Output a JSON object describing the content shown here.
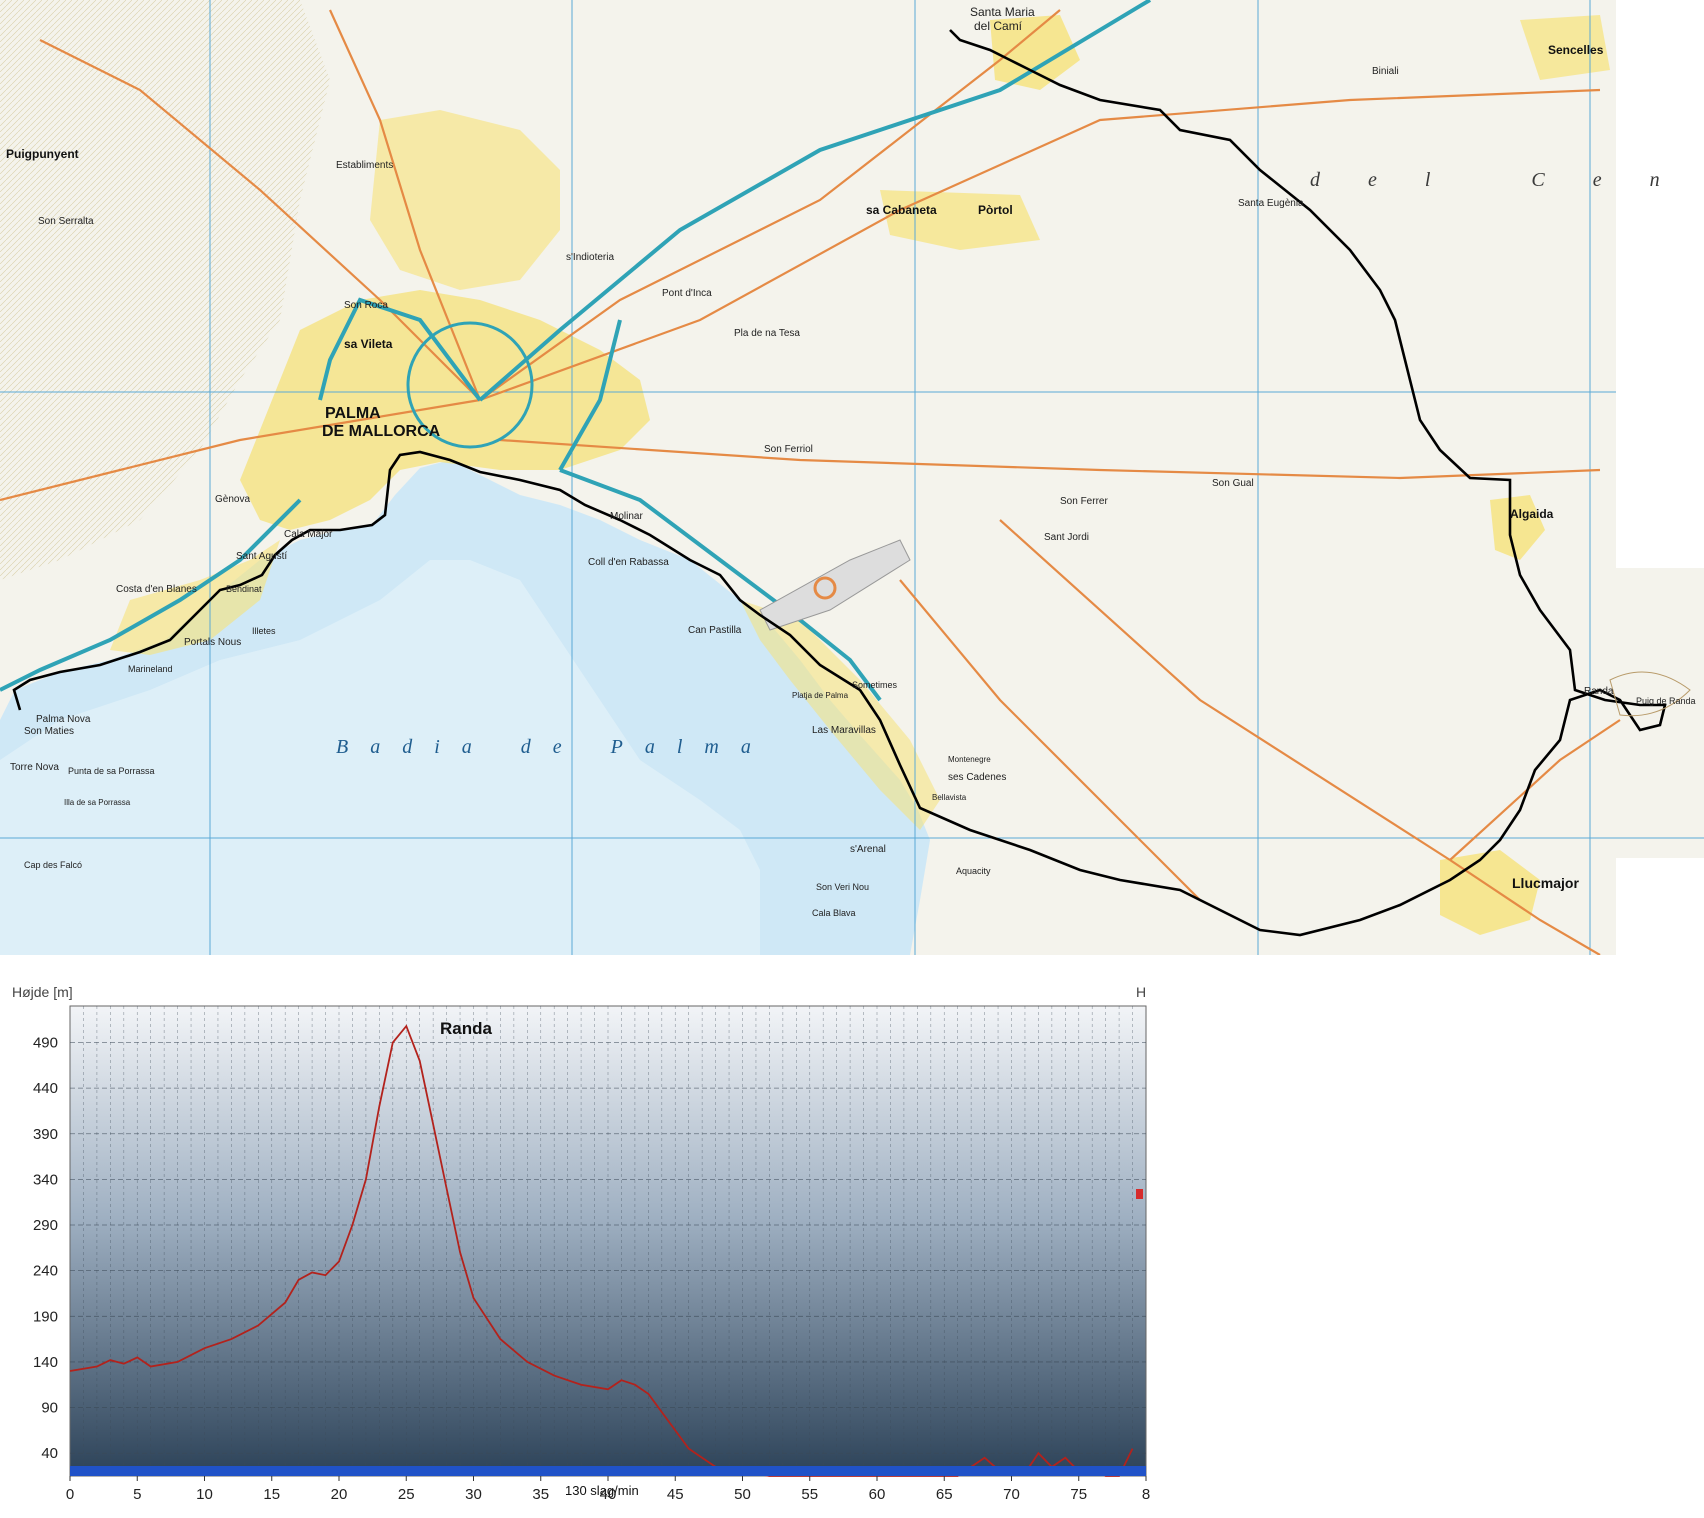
{
  "map": {
    "bay_name": "Badia de Palma",
    "region_name": "del Centro",
    "places": [
      {
        "name": "PALMA",
        "kind": "major"
      },
      {
        "name": "DE MALLORCA",
        "kind": "major"
      },
      {
        "name": "Santa Maria",
        "kind": "town"
      },
      {
        "name": "del Camí",
        "kind": "town"
      },
      {
        "name": "Sencelles",
        "kind": "town"
      },
      {
        "name": "Biniali",
        "kind": "small"
      },
      {
        "name": "Puigpunyent",
        "kind": "town"
      },
      {
        "name": "Establiments",
        "kind": "small"
      },
      {
        "name": "sa Cabaneta",
        "kind": "town"
      },
      {
        "name": "Pòrtol",
        "kind": "town"
      },
      {
        "name": "Santa Eugènia",
        "kind": "small"
      },
      {
        "name": "s'Indioteria",
        "kind": "small"
      },
      {
        "name": "Pont d'Inca",
        "kind": "small"
      },
      {
        "name": "Son Roca",
        "kind": "small"
      },
      {
        "name": "sa Vileta",
        "kind": "town"
      },
      {
        "name": "Pla de na Tesa",
        "kind": "small"
      },
      {
        "name": "Son Serralta",
        "kind": "small"
      },
      {
        "name": "Son Ferriol",
        "kind": "small"
      },
      {
        "name": "Gènova",
        "kind": "small"
      },
      {
        "name": "Sant Agustí",
        "kind": "small"
      },
      {
        "name": "Cala Major",
        "kind": "small"
      },
      {
        "name": "Coll d'en Rabassa",
        "kind": "small"
      },
      {
        "name": "Molinar",
        "kind": "small"
      },
      {
        "name": "Son Gual",
        "kind": "small"
      },
      {
        "name": "Son Ferrer",
        "kind": "small"
      },
      {
        "name": "Sant Jordi",
        "kind": "small"
      },
      {
        "name": "Algaida",
        "kind": "town"
      },
      {
        "name": "Randa",
        "kind": "small"
      },
      {
        "name": "Puig de Randa",
        "kind": "small"
      },
      {
        "name": "Can Pastilla",
        "kind": "small"
      },
      {
        "name": "Las Maravillas",
        "kind": "small"
      },
      {
        "name": "Marineland",
        "kind": "poi"
      },
      {
        "name": "Portals Nous",
        "kind": "small"
      },
      {
        "name": "Costa d'en Blanes",
        "kind": "small"
      },
      {
        "name": "Palma Nova",
        "kind": "small"
      },
      {
        "name": "Son Maties",
        "kind": "small"
      },
      {
        "name": "Torre Nova",
        "kind": "small"
      },
      {
        "name": "Punta de sa Porrassa",
        "kind": "small"
      },
      {
        "name": "Illa de sa Porrassa",
        "kind": "small"
      },
      {
        "name": "Cap des Falcó",
        "kind": "small"
      },
      {
        "name": "s'Arenal",
        "kind": "small"
      },
      {
        "name": "ses Cadenes",
        "kind": "small"
      },
      {
        "name": "Llucmajor",
        "kind": "major"
      },
      {
        "name": "Aquacity",
        "kind": "poi"
      },
      {
        "name": "Illetes",
        "kind": "small"
      },
      {
        "name": "Bendinat",
        "kind": "small"
      },
      {
        "name": "Sometimes",
        "kind": "small"
      },
      {
        "name": "Platja de Palma",
        "kind": "small"
      },
      {
        "name": "Son Veri Nou",
        "kind": "small"
      },
      {
        "name": "Cala Blava",
        "kind": "small"
      },
      {
        "name": "Bellavista",
        "kind": "small"
      },
      {
        "name": "Montenegre",
        "kind": "small"
      }
    ]
  },
  "profile": {
    "y_title": "Højde [m]",
    "right_corner": "H",
    "peak_label": "Randa",
    "hr_label": "130 slag/min",
    "y_ticks": [
      "490",
      "440",
      "390",
      "340",
      "290",
      "240",
      "190",
      "140",
      "90",
      "40"
    ],
    "x_ticks": [
      "0",
      "5",
      "10",
      "15",
      "20",
      "25",
      "30",
      "35",
      "40",
      "45",
      "50",
      "55",
      "60",
      "65",
      "70",
      "75",
      "8"
    ]
  },
  "chart_data": {
    "type": "area",
    "title": "",
    "ylabel": "Højde [m]",
    "xlabel": "",
    "xlim": [
      0,
      80
    ],
    "ylim": [
      15,
      530
    ],
    "grid": true,
    "x": [
      0,
      2,
      3,
      4,
      5,
      6,
      8,
      10,
      12,
      14,
      16,
      17,
      18,
      19,
      20,
      21,
      22,
      23,
      24,
      25,
      26,
      27,
      28,
      29,
      30,
      32,
      34,
      36,
      38,
      40,
      41,
      42,
      43,
      44,
      45,
      46,
      47,
      48,
      50,
      52,
      54,
      56,
      58,
      60,
      62,
      64,
      66,
      67,
      68,
      69,
      70,
      71,
      72,
      73,
      74,
      75,
      76,
      77,
      78,
      79
    ],
    "y": [
      130,
      135,
      142,
      138,
      145,
      135,
      140,
      155,
      165,
      180,
      205,
      230,
      238,
      235,
      250,
      290,
      340,
      420,
      490,
      508,
      470,
      400,
      330,
      260,
      210,
      165,
      140,
      125,
      115,
      110,
      120,
      115,
      105,
      85,
      65,
      45,
      35,
      25,
      20,
      15,
      10,
      10,
      10,
      10,
      10,
      10,
      10,
      25,
      35,
      22,
      20,
      18,
      40,
      25,
      35,
      20,
      22,
      15,
      12,
      45
    ]
  }
}
